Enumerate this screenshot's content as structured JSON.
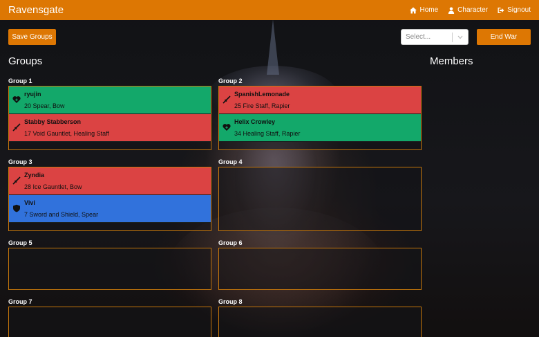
{
  "nav": {
    "brand": "Ravensgate",
    "links": [
      {
        "label": "Home",
        "icon": "home-icon"
      },
      {
        "label": "Character",
        "icon": "user-icon"
      },
      {
        "label": "Signout",
        "icon": "signout-icon"
      }
    ]
  },
  "toolbar": {
    "save_label": "Save Groups",
    "select_placeholder": "Select...",
    "end_war_label": "End War"
  },
  "headings": {
    "groups": "Groups",
    "members": "Members"
  },
  "colors": {
    "accent": "#dd7703",
    "healer": "#13a86a",
    "dps": "#db4343",
    "tank": "#3172dc"
  },
  "groups": [
    {
      "label": "Group 1",
      "members": [
        {
          "name": "ryujin",
          "info": "20  Spear, Bow",
          "role": "healer",
          "icon": "healer-heart-icon"
        },
        {
          "name": "Stabby Stabberson",
          "info": "17  Void Gauntlet, Healing Staff",
          "role": "dps",
          "icon": "sword-icon"
        }
      ]
    },
    {
      "label": "Group 2",
      "members": [
        {
          "name": "SpanishLemonade",
          "info": "25  Fire Staff, Rapier",
          "role": "dps",
          "icon": "sword-icon"
        },
        {
          "name": "Helix Crowley",
          "info": "34  Healing Staff, Rapier",
          "role": "healer",
          "icon": "healer-heart-icon"
        }
      ]
    },
    {
      "label": "Group 3",
      "members": [
        {
          "name": "Zyndia",
          "info": "28  Ice Gauntlet, Bow",
          "role": "dps",
          "icon": "sword-icon"
        },
        {
          "name": "Vivi",
          "info": "7  Sword and Shield, Spear",
          "role": "tank",
          "icon": "shield-icon"
        }
      ]
    },
    {
      "label": "Group 4",
      "members": []
    },
    {
      "label": "Group 5",
      "members": []
    },
    {
      "label": "Group 6",
      "members": []
    },
    {
      "label": "Group 7",
      "members": []
    },
    {
      "label": "Group 8",
      "members": []
    }
  ]
}
